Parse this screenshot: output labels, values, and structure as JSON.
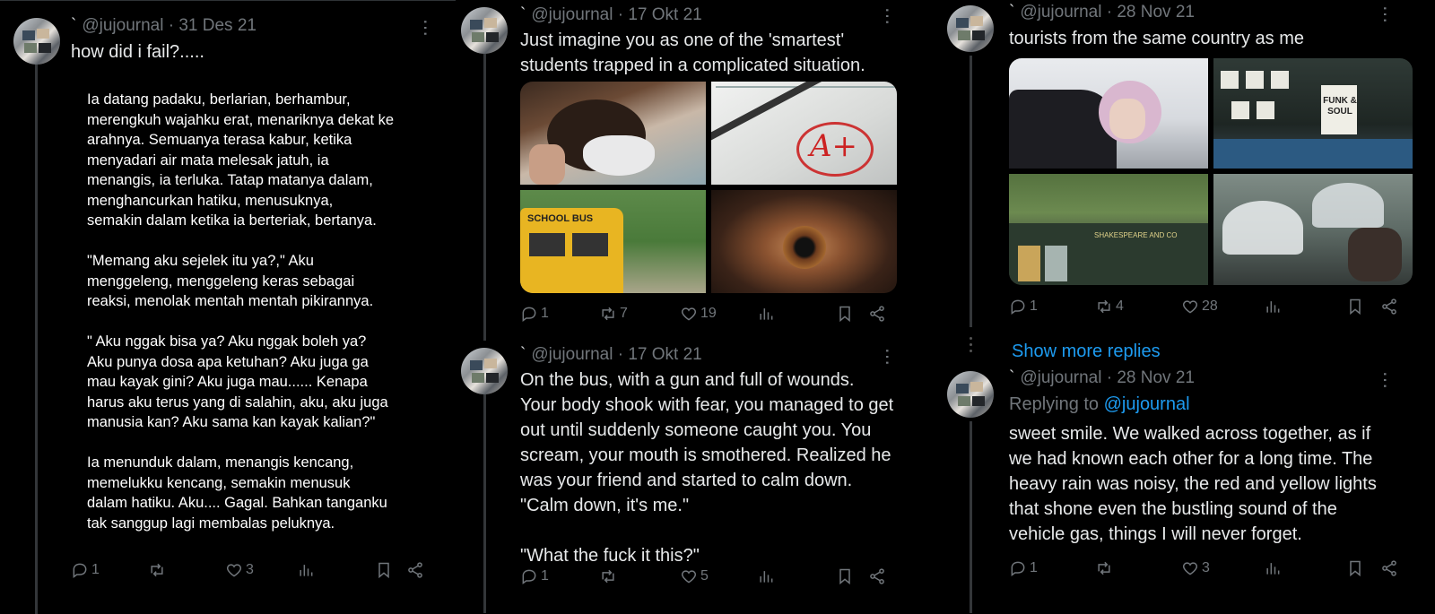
{
  "posts": [
    {
      "handle": "@jujournal",
      "date": "· 31 Des 21",
      "text": "how did i fail?.....",
      "poem": "Ia datang padaku, berlarian, berhambur,\nmerengkuh wajahku erat, menariknya dekat ke\narahnya. Semuanya terasa kabur, ketika\nmenyadari air mata melesak jatuh, ia\nmenangis, ia terluka. Tatap matanya dalam,\nmenghancurkan hatiku, menusuknya,\nsemakin dalam ketika ia berteriak, bertanya.\n\n\"Memang aku sejelek itu ya?,\" Aku\nmenggeleng, menggeleng keras sebagai\nreaksi, menolak mentah mentah pikirannya.\n\n\" Aku nggak bisa ya? Aku nggak boleh ya?\nAku punya dosa apa ketuhan? Aku juga ga\nmau kayak gini? Aku juga mau...... Kenapa\nharus aku terus yang di salahin, aku, aku juga\nmanusia kan? Aku sama kan kayak kalian?\"\n\nIa menunduk dalam, menangis kencang,\nmemelukku kencang, semakin menusuk\ndalam hatiku. Aku.... Gagal. Bahkan tanganku\ntak sanggup lagi membalas peluknya.",
      "replies": "1",
      "reposts": "",
      "likes": "3"
    },
    {
      "handle": "@jujournal",
      "date": "· 17 Okt 21",
      "text": "Just imagine you as one of the 'smartest'\nstudents trapped in a complicated situation.",
      "image_text": {
        "grade": "A+",
        "bus_sign": "SCHOOL BUS"
      },
      "replies": "1",
      "reposts": "7",
      "likes": "19"
    },
    {
      "handle": "@jujournal",
      "date": "· 17 Okt 21",
      "text": "On the bus, with a gun and full of wounds.\nYour body shook with fear, you managed to get\nout until suddenly someone caught you. You\nscream, your mouth is smothered. Realized he\nwas your friend and started to calm down.\n\"Calm down, it's me.\"\n\n\"What the fuck it this?\"",
      "replies": "1",
      "reposts": "",
      "likes": "5"
    },
    {
      "handle": "@jujournal",
      "date": "· 28 Nov 21",
      "text": "tourists from the same country as me",
      "image_text": {
        "record_sign": "FUNK & SOUL",
        "shop_sign": "SHAKESPEARE AND CO"
      },
      "replies": "1",
      "reposts": "4",
      "likes": "28"
    },
    {
      "handle": "@jujournal",
      "date": "· 28 Nov 21",
      "replying_label": "Replying to",
      "replying_to": "@jujournal",
      "text": "sweet smile. We walked across together, as if\nwe had known each other for a long time. The\nheavy rain was noisy, the red and yellow lights\nthat shone even the bustling sound of the\nvehicle gas, things I will never forget.",
      "replies": "1",
      "reposts": "",
      "likes": "3"
    }
  ],
  "show_more": "Show more replies",
  "tick": "`",
  "colors": {
    "background": "#000000",
    "text": "#e7e9ea",
    "muted": "#71767b",
    "link": "#1d9bf0"
  }
}
